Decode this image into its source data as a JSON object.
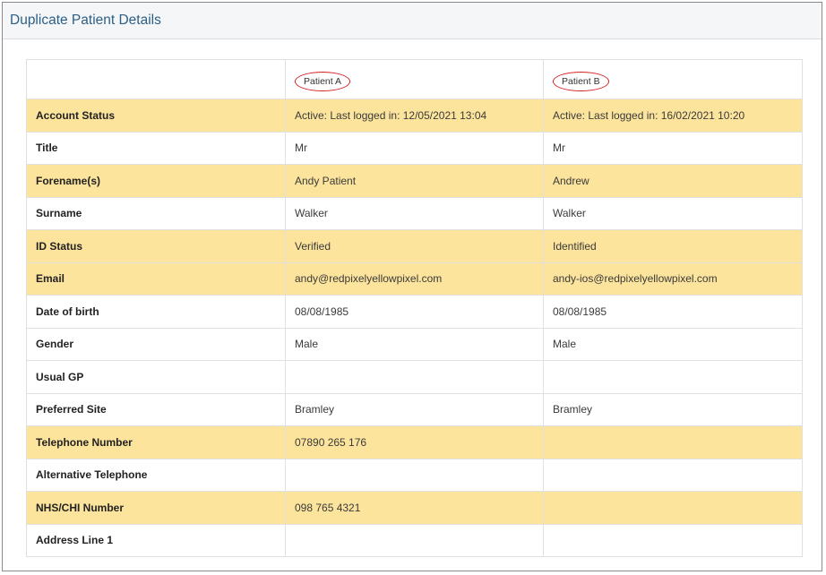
{
  "panel": {
    "title": "Duplicate Patient Details"
  },
  "columns": {
    "patient_a": "Patient A",
    "patient_b": "Patient B"
  },
  "accent_colors": {
    "highlight_row": "#fde49c",
    "title_text": "#2c5f86",
    "circle": "#d31f1f"
  },
  "rows": [
    {
      "label": "Account Status",
      "a": "Active: Last logged in: 12/05/2021 13:04",
      "b": "Active: Last logged in: 16/02/2021 10:20",
      "highlight": true
    },
    {
      "label": "Title",
      "a": "Mr",
      "b": "Mr",
      "highlight": false
    },
    {
      "label": "Forename(s)",
      "a": "Andy Patient",
      "b": "Andrew",
      "highlight": true
    },
    {
      "label": "Surname",
      "a": "Walker",
      "b": "Walker",
      "highlight": false
    },
    {
      "label": "ID Status",
      "a": "Verified",
      "b": "Identified",
      "highlight": true
    },
    {
      "label": "Email",
      "a": "andy@redpixelyellowpixel.com",
      "b": "andy-ios@redpixelyellowpixel.com",
      "highlight": true
    },
    {
      "label": "Date of birth",
      "a": "08/08/1985",
      "b": "08/08/1985",
      "highlight": false
    },
    {
      "label": "Gender",
      "a": "Male",
      "b": "Male",
      "highlight": false
    },
    {
      "label": "Usual GP",
      "a": "",
      "b": "",
      "highlight": false
    },
    {
      "label": "Preferred Site",
      "a": "Bramley",
      "b": "Bramley",
      "highlight": false
    },
    {
      "label": "Telephone Number",
      "a": "07890 265 176",
      "b": "",
      "highlight": true
    },
    {
      "label": "Alternative Telephone",
      "a": "",
      "b": "",
      "highlight": false
    },
    {
      "label": "NHS/CHI Number",
      "a": "098 765 4321",
      "b": "",
      "highlight": true
    },
    {
      "label": "Address Line 1",
      "a": "",
      "b": "",
      "highlight": false
    }
  ]
}
